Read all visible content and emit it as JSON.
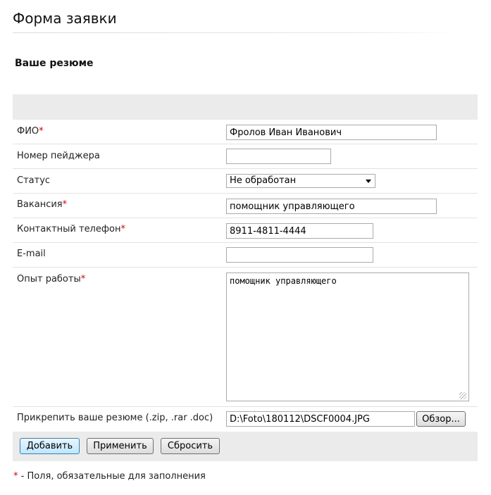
{
  "page": {
    "title": "Форма заявки",
    "section_title": "Ваше резюме"
  },
  "form": {
    "fields": {
      "fio": {
        "label": "ФИО",
        "required_mark": "*",
        "value": "Фролов Иван Иванович"
      },
      "pager": {
        "label": "Номер пейджера",
        "value": ""
      },
      "status": {
        "label": "Статус",
        "value": "Не обработан"
      },
      "vacancy": {
        "label": "Вакансия",
        "required_mark": "*",
        "value": "помощник управляющего"
      },
      "phone": {
        "label": "Контактный телефон",
        "required_mark": "*",
        "value": "8911-4811-4444"
      },
      "email": {
        "label": "E-mail",
        "value": ""
      },
      "experience": {
        "label": "Опыт работы",
        "required_mark": "*",
        "value": "помощник управляющего"
      },
      "attachment": {
        "label": "Прикрепить ваше резюме (.zip, .rar .doc)",
        "value": "D:\\Foto\\180112\\DSCF0004.JPG",
        "browse_label": "Обзор..."
      }
    },
    "buttons": {
      "add": "Добавить",
      "apply": "Применить",
      "reset": "Сбросить"
    }
  },
  "footnote": {
    "mark": "*",
    "text": " - Поля, обязательные для заполнения"
  },
  "colors": {
    "required": "#d40000",
    "band": "#ebebeb",
    "primary_button": "#bee6fd"
  }
}
